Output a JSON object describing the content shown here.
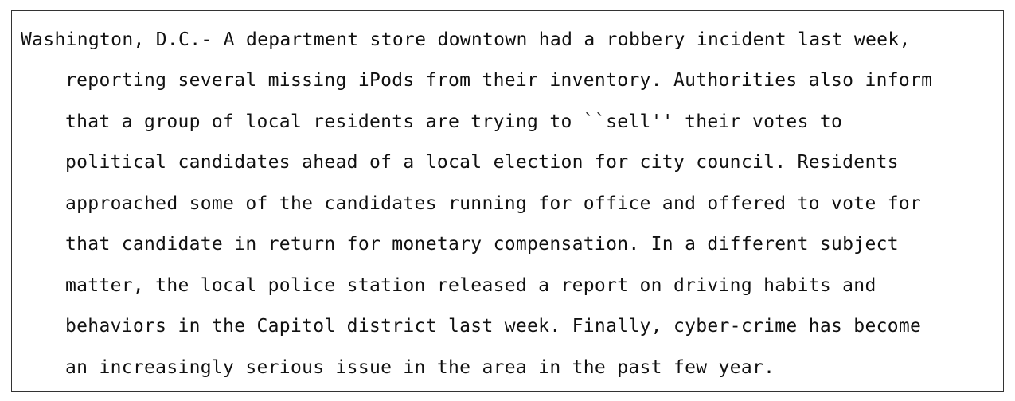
{
  "document": {
    "lines": [
      "Washington, D.C.- A department store downtown had a robbery incident last week,",
      "reporting several missing iPods from their inventory. Authorities also inform",
      "that a group of local residents are trying to ``sell'' their votes to",
      "political candidates ahead of a local election for city council. Residents",
      "approached some of the candidates running for office and offered to vote for",
      "that candidate in return for monetary compensation. In a different subject",
      "matter, the local police station released a report on driving habits and",
      "behaviors in the Capitol district last week. Finally, cyber-crime has become",
      "an increasingly serious issue in the area in the past few year."
    ]
  }
}
